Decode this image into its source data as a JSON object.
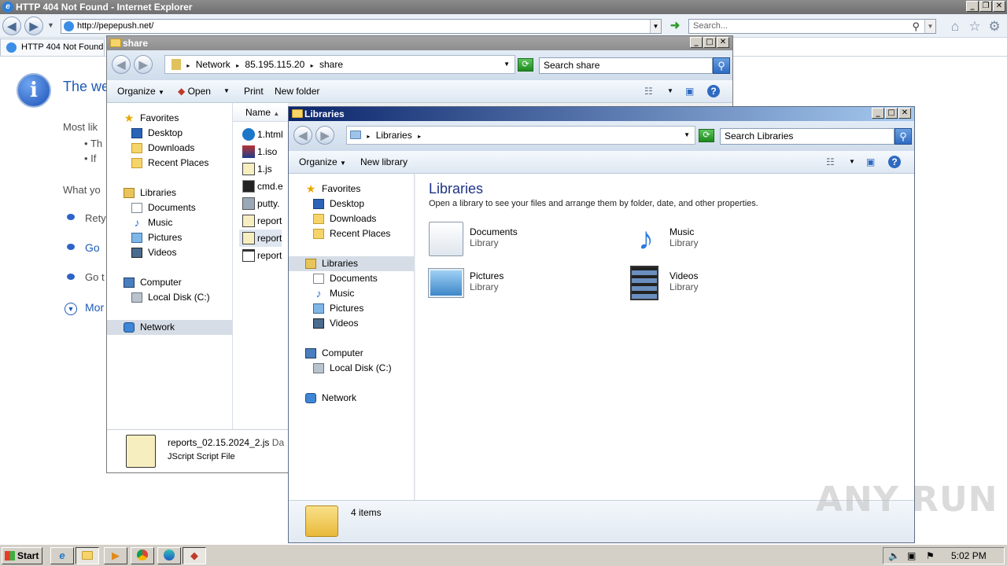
{
  "ie": {
    "title": "HTTP 404 Not Found - Internet Explorer",
    "address": "http://pepepush.net/",
    "search_placeholder": "Search...",
    "tab_label": "HTTP 404 Not Found",
    "content": {
      "heading": "The we",
      "most_likely": "Most lik",
      "bullet1": "Th",
      "bullet2": "If",
      "what_you": "What yo",
      "link1": "Rety",
      "link2": "Go",
      "link3": "Go t",
      "more": "Mor"
    }
  },
  "share": {
    "title": "share",
    "breadcrumb": [
      "Network",
      "85.195.115.20",
      "share"
    ],
    "search_placeholder": "Search share",
    "toolbar": [
      "Organize",
      "Open",
      "Print",
      "New folder"
    ],
    "nav": {
      "favorites": "Favorites",
      "desktop": "Desktop",
      "downloads": "Downloads",
      "recent": "Recent Places",
      "libraries": "Libraries",
      "documents": "Documents",
      "music": "Music",
      "pictures": "Pictures",
      "videos": "Videos",
      "computer": "Computer",
      "local_disk": "Local Disk (C:)",
      "network": "Network"
    },
    "column_name": "Name",
    "files": [
      "1.html",
      "1.iso",
      "1.js",
      "cmd.e",
      "putty.",
      "report",
      "report",
      "report"
    ],
    "details": {
      "filename": "reports_02.15.2024_2.js",
      "date_prefix": "Da",
      "filetype": "JScript Script File"
    }
  },
  "libraries": {
    "title": "Libraries",
    "breadcrumb": "Libraries",
    "search_placeholder": "Search Libraries",
    "toolbar": [
      "Organize",
      "New library"
    ],
    "nav": {
      "favorites": "Favorites",
      "desktop": "Desktop",
      "downloads": "Downloads",
      "recent": "Recent Places",
      "libraries": "Libraries",
      "documents": "Documents",
      "music": "Music",
      "pictures": "Pictures",
      "videos": "Videos",
      "computer": "Computer",
      "local_disk": "Local Disk (C:)",
      "network": "Network"
    },
    "heading": "Libraries",
    "subtitle": "Open a library to see your files and arrange them by folder, date, and other properties.",
    "items": [
      {
        "name": "Documents",
        "type": "Library"
      },
      {
        "name": "Music",
        "type": "Library"
      },
      {
        "name": "Pictures",
        "type": "Library"
      },
      {
        "name": "Videos",
        "type": "Library"
      }
    ],
    "status": "4 items"
  },
  "taskbar": {
    "start": "Start",
    "clock": "5:02 PM"
  },
  "watermark": "ANY RUN"
}
